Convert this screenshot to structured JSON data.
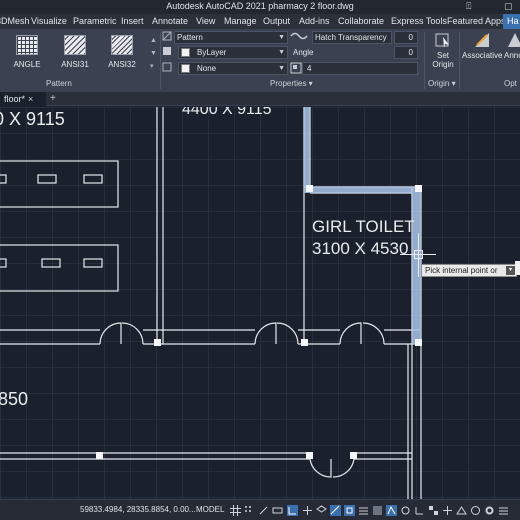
{
  "window": {
    "title": "Autodesk AutoCAD 2021    pharmacy 2 floor.dwg"
  },
  "menu": {
    "tabs": [
      "3DMesh",
      "Visualize",
      "Parametric",
      "Insert",
      "Annotate",
      "View",
      "Manage",
      "Output",
      "Add-ins",
      "Collaborate",
      "Express Tools",
      "Featured Apps",
      "Ha"
    ],
    "active_index": 12
  },
  "ribbon": {
    "patterns": [
      "ANGLE",
      "ANSI31",
      "ANSI32"
    ],
    "pattern_panel_label": "Pattern",
    "properties_panel_label": "Properties ▾",
    "origin_panel_label": "Origin ▾",
    "type_value": "Pattern",
    "color_value": "ByLayer",
    "background_value": "None",
    "transparency_label": "Hatch Transparency",
    "transparency_value": "0",
    "angle_label": "Angle",
    "angle_value": "0",
    "scale_value": "4",
    "set_origin_label_1": "Set",
    "set_origin_label_2": "Origin",
    "associative_label": "Associative",
    "annotative_label": "Anno",
    "options_label": "Opt"
  },
  "tabs": {
    "document": "floor*",
    "close": "×",
    "new": "+"
  },
  "drawing": {
    "room_top_label": "4400 X 9115",
    "room_left_label": "0 X 9115",
    "girl_toilet_name": "GIRL TOILET",
    "girl_toilet_dims": "3100 X 4530",
    "left_dim": "850",
    "tooltip": "Pick internal point or"
  },
  "status": {
    "coords": "59833.4984, 28335.8854, 0.00...",
    "model": "MODEL"
  },
  "colors": {
    "accent": "#3a6fb0",
    "highlight": "#a8c4ea",
    "canvas": "#1b212c",
    "line": "#e9ecef"
  }
}
